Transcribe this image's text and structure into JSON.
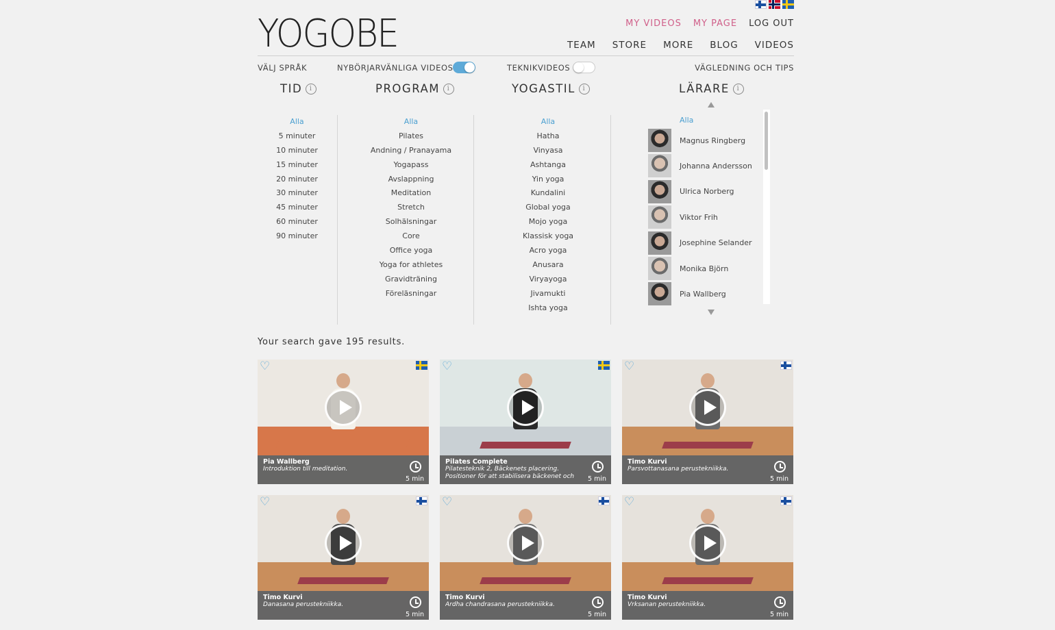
{
  "brand": {
    "logo": "YOGOBE"
  },
  "languages": [
    {
      "code": "fi",
      "icon": "finland-flag"
    },
    {
      "code": "no",
      "icon": "norway-flag"
    },
    {
      "code": "se",
      "icon": "sweden-flag"
    }
  ],
  "topnav": {
    "my_videos": "MY VIDEOS",
    "my_page": "MY PAGE",
    "log_out": "LOG OUT"
  },
  "mainnav": {
    "team": "TEAM",
    "store": "STORE",
    "more": "MORE",
    "blog": "BLOG",
    "videos": "VIDEOS"
  },
  "filterbar": {
    "language": "VÄLJ SPRÅK",
    "beginner": "NYBÖRJARVÄNLIGA VIDEOS",
    "beginner_on": true,
    "technique": "TEKNIKVIDEOS",
    "technique_on": false,
    "guide": "VÄGLEDNING OCH TIPS"
  },
  "columns": {
    "tid": {
      "title": "TID",
      "items": [
        "Alla",
        "5 minuter",
        "10 minuter",
        "15 minuter",
        "20 minuter",
        "30 minuter",
        "45 minuter",
        "60 minuter",
        "90 minuter"
      ]
    },
    "program": {
      "title": "PROGRAM",
      "items": [
        "Alla",
        "Pilates",
        "Andning / Pranayama",
        "Yogapass",
        "Avslappning",
        "Meditation",
        "Stretch",
        "Solhälsningar",
        "Core",
        "Office yoga",
        "Yoga for athletes",
        "Gravidträning",
        "Föreläsningar"
      ]
    },
    "yogastil": {
      "title": "YOGASTIL",
      "items": [
        "Alla",
        "Hatha",
        "Vinyasa",
        "Ashtanga",
        "Yin yoga",
        "Kundalini",
        "Global yoga",
        "Mojo yoga",
        "Klassisk yoga",
        "Acro yoga",
        "Anusara",
        "Viryayoga",
        "Jivamukti",
        "Ishta yoga"
      ]
    },
    "larare": {
      "title": "LÄRARE",
      "all": "Alla",
      "items": [
        "Magnus Ringberg",
        "Johanna Andersson",
        "Ulrica Norberg",
        "Viktor Frih",
        "Josephine Selander",
        "Monika Björn",
        "Pia Wallberg"
      ]
    }
  },
  "results_text": "Your search gave 195 results.",
  "videos": [
    {
      "teacher": "Pia Wallberg",
      "desc": "Introduktion till meditation.",
      "duration": "5 min",
      "flag": "se"
    },
    {
      "teacher": "Pilates Complete",
      "desc": "Pilatesteknik 2, Bäckenets placering. Positioner för att stabilisera bäckenet och",
      "duration": "5 min",
      "flag": "se"
    },
    {
      "teacher": "Timo Kurvi",
      "desc": "Parsvottanasana perustekniikka.",
      "duration": "5 min",
      "flag": "fi"
    },
    {
      "teacher": "Timo Kurvi",
      "desc": "Danasana perustekniikka.",
      "duration": "5 min",
      "flag": "fi"
    },
    {
      "teacher": "Timo Kurvi",
      "desc": "Ardha chandrasana perustekniikka.",
      "duration": "5 min",
      "flag": "fi"
    },
    {
      "teacher": "Timo Kurvi",
      "desc": "Vrksanan perustekniikka.",
      "duration": "5 min",
      "flag": "fi"
    }
  ],
  "colors": {
    "accent_blue": "#5eaad8",
    "nav_pink": "#d0608a",
    "card_bar": "#5a5a5a"
  }
}
